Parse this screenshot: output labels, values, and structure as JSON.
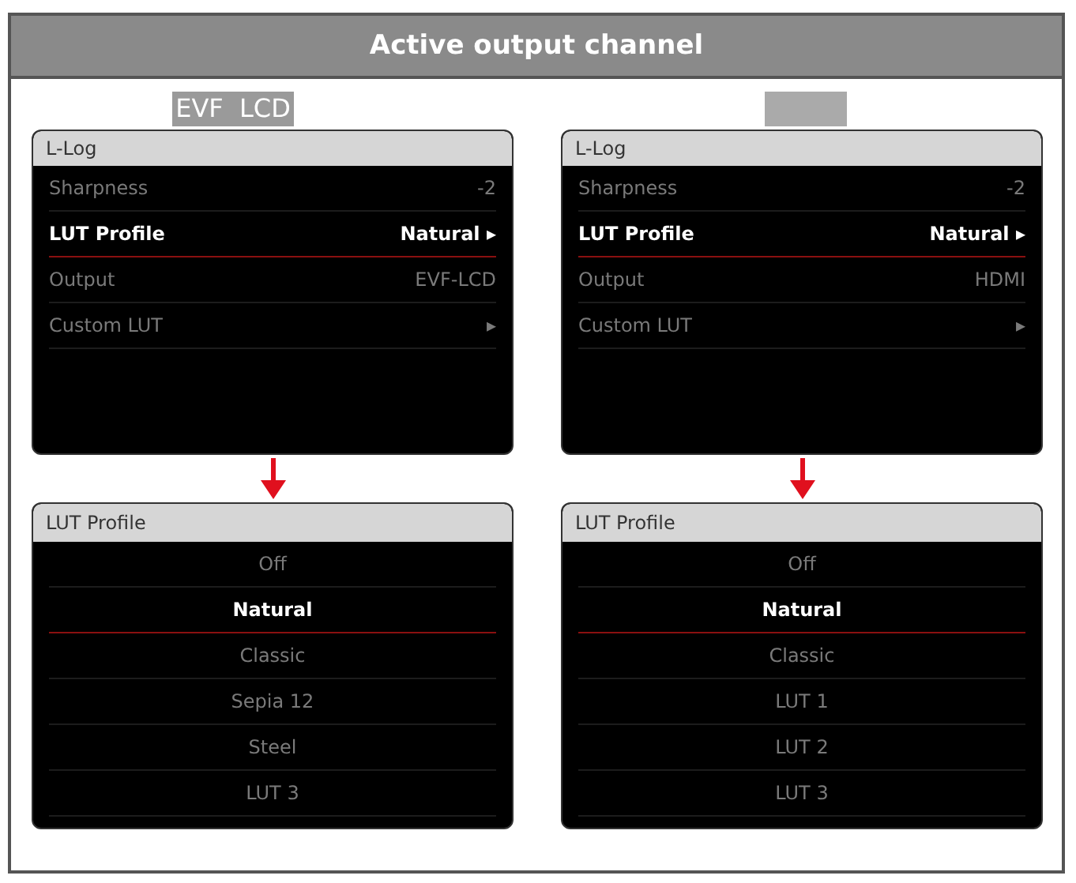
{
  "title": "Active output channel",
  "columns": [
    {
      "channel_label": "EVF  LCD",
      "menu": {
        "title": "L-Log",
        "rows": [
          {
            "label": "Sharpness",
            "value": "-2",
            "selected": false
          },
          {
            "label": "LUT Profile",
            "value": "Natural ▸",
            "selected": true
          },
          {
            "label": "Output",
            "value": "EVF-LCD",
            "selected": false
          },
          {
            "label": "Custom LUT",
            "value": "▸",
            "selected": false
          }
        ]
      },
      "submenu": {
        "title": "LUT Profile",
        "options": [
          {
            "label": "Off",
            "selected": false
          },
          {
            "label": "Natural",
            "selected": true
          },
          {
            "label": "Classic",
            "selected": false
          },
          {
            "label": "Sepia 12",
            "selected": false
          },
          {
            "label": "Steel",
            "selected": false
          },
          {
            "label": "LUT 3",
            "selected": false
          }
        ]
      }
    },
    {
      "menu": {
        "title": "L-Log",
        "rows": [
          {
            "label": "Sharpness",
            "value": "-2",
            "selected": false
          },
          {
            "label": "LUT Profile",
            "value": "Natural ▸",
            "selected": true
          },
          {
            "label": "Output",
            "value": "HDMI",
            "selected": false
          },
          {
            "label": "Custom LUT",
            "value": "▸",
            "selected": false
          }
        ]
      },
      "submenu": {
        "title": "LUT Profile",
        "options": [
          {
            "label": "Off",
            "selected": false
          },
          {
            "label": "Natural",
            "selected": true
          },
          {
            "label": "Classic",
            "selected": false
          },
          {
            "label": "LUT 1",
            "selected": false
          },
          {
            "label": "LUT 2",
            "selected": false
          },
          {
            "label": "LUT 3",
            "selected": false
          }
        ]
      }
    }
  ]
}
